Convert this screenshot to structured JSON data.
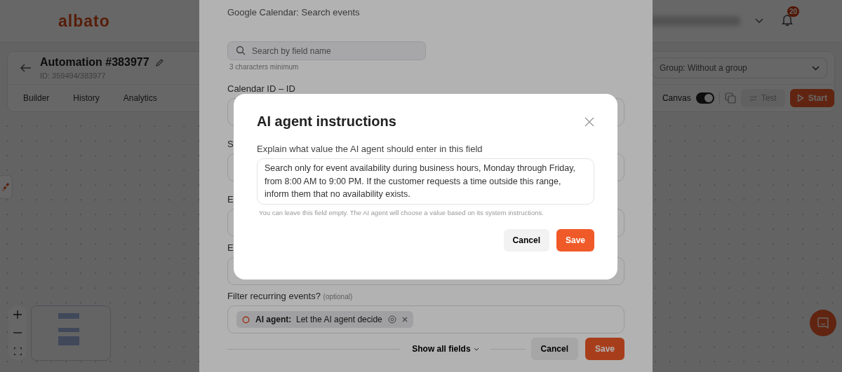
{
  "app": {
    "logo": "albato",
    "notifications": "20",
    "automation": {
      "title": "Automation #383977",
      "id": "ID: 359494/383977"
    },
    "tabs": [
      {
        "label": "Builder"
      },
      {
        "label": "History"
      },
      {
        "label": "Analytics"
      }
    ],
    "group_select": "Group: Without a group",
    "canvas_toggle": {
      "label": "Canvas",
      "on": true
    },
    "test_button": "Test",
    "start_button": "Start"
  },
  "panel": {
    "subtitle": "Google Calendar: Search events",
    "search": {
      "placeholder": "Search by field name"
    },
    "search_hint": "3 characters minimum",
    "fields": [
      {
        "label": "Calendar ID – ID"
      },
      {
        "label": "S"
      },
      {
        "label": "E"
      },
      {
        "label": "E"
      }
    ],
    "filter_field": {
      "label": "Filter recurring events?",
      "note": "(optional)",
      "chip": {
        "prefix": "AI agent:",
        "value": "Let the AI agent decide"
      }
    },
    "show_all": "Show all fields",
    "cancel": "Cancel",
    "save": "Save"
  },
  "modal": {
    "title": "AI agent instructions",
    "prompt": "Explain what value the AI agent should enter in this field",
    "value": "Search only for event availability during business hours, Monday through Friday, from 8:00 AM to 9:00 PM. If the customer requests a time outside this range, inform them that no availability exists.",
    "hint": "You can leave this field empty. The AI agent will choose a value based on its system instructions.",
    "cancel": "Cancel",
    "save": "Save"
  }
}
